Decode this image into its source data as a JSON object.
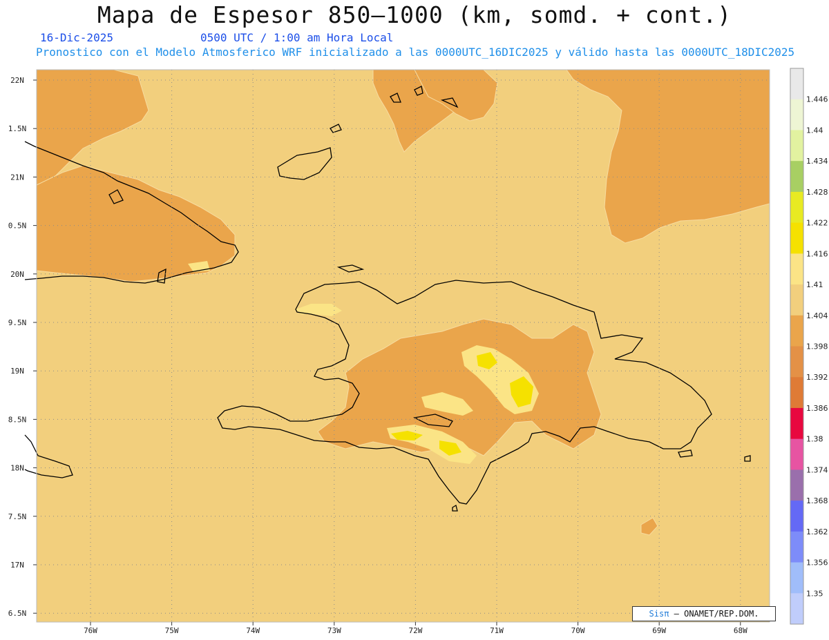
{
  "header": {
    "title": "Mapa de Espesor 850–1000 (km, somd. + cont.)",
    "date": "16-Dic-2025",
    "time": "0500 UTC / 1:00 am Hora Local",
    "description": "Pronostico con el Modelo Atmosferico WRF inicializado a las 0000UTC_16DIC2025 y válido hasta las  0000UTC_18DIC2025"
  },
  "map": {
    "lat_labels": [
      "22N",
      "1.5N",
      "21N",
      "0.5N",
      "20N",
      "9.5N",
      "19N",
      "8.5N",
      "18N",
      "7.5N",
      "17N",
      "6.5N"
    ],
    "lon_labels": [
      "76W",
      "75W",
      "74W",
      "73W",
      "72W",
      "71W",
      "70W",
      "69W",
      "68W"
    ],
    "colors": {
      "background_field": "#f2cf7d",
      "orange": "#eaa54b",
      "dark_orange": "#e49146",
      "light_yellow": "#fbe486",
      "yellow": "#f5e21a",
      "coast": "#000000",
      "grid": "#8a8a8a"
    }
  },
  "colorbar": {
    "labels": [
      "1.446",
      "1.44",
      "1.434",
      "1.428",
      "1.422",
      "1.416",
      "1.41",
      "1.404",
      "1.398",
      "1.392",
      "1.386",
      "1.38",
      "1.374",
      "1.368",
      "1.362",
      "1.356",
      "1.35"
    ],
    "colors": [
      "#e9e9e9",
      "#eef5d4",
      "#e2f2a0",
      "#a8cf63",
      "#e8ea22",
      "#f5e100",
      "#fbe486",
      "#f2cf7d",
      "#eaa54b",
      "#e49146",
      "#df7b36",
      "#e8083f",
      "#e754a2",
      "#9a6fac",
      "#6469f5",
      "#7d8cf9",
      "#a0bdfa",
      "#c0cdfb"
    ]
  },
  "credit": {
    "logo": "Sisπ",
    "text": " – ONAMET/REP.DOM."
  }
}
